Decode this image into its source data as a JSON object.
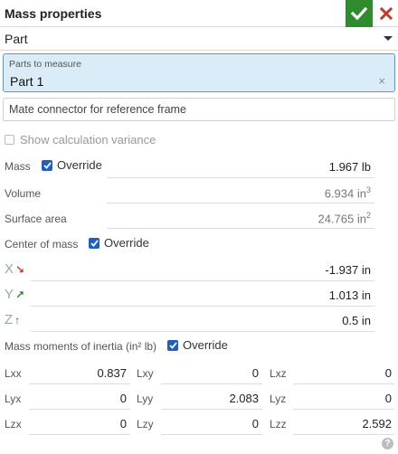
{
  "header": {
    "title": "Mass properties"
  },
  "mode": {
    "selected": "Part"
  },
  "parts": {
    "label": "Parts to measure",
    "value": "Part 1",
    "clear_glyph": "×"
  },
  "mate_connector": {
    "placeholder": "Mate connector for reference frame"
  },
  "variance": {
    "label": "Show calculation variance"
  },
  "override_label": "Override",
  "mass": {
    "label": "Mass",
    "value": "1.967 lb"
  },
  "volume": {
    "label": "Volume",
    "value": "6.934 in",
    "exp": "3"
  },
  "surface_area": {
    "label": "Surface area",
    "value": "24.765 in",
    "exp": "2"
  },
  "center_of_mass": {
    "label": "Center of mass",
    "x": {
      "axis": "X",
      "arrow": "↘",
      "value": "-1.937 in"
    },
    "y": {
      "axis": "Y",
      "arrow": "↗",
      "value": "1.013 in"
    },
    "z": {
      "axis": "Z",
      "arrow": "↑",
      "value": "0.5 in"
    }
  },
  "inertia": {
    "label": "Mass moments of inertia (in² lb)",
    "cells": [
      [
        {
          "label": "Lxx",
          "value": "0.837"
        },
        {
          "label": "Lxy",
          "value": "0"
        },
        {
          "label": "Lxz",
          "value": "0"
        }
      ],
      [
        {
          "label": "Lyx",
          "value": "0"
        },
        {
          "label": "Lyy",
          "value": "2.083"
        },
        {
          "label": "Lyz",
          "value": "0"
        }
      ],
      [
        {
          "label": "Lzx",
          "value": "0"
        },
        {
          "label": "Lzy",
          "value": "0"
        },
        {
          "label": "Lzz",
          "value": "2.592"
        }
      ]
    ]
  },
  "colors": {
    "accept": "#2e8b2e",
    "cancel": "#c0392b",
    "checkbox": "#1f5fbf",
    "selection_bg": "#d9ecf7",
    "x_axis": "#c0392b",
    "y_axis": "#2e8b2e",
    "z_axis": "#1f5fbf"
  },
  "icons": {
    "accept": "check-icon",
    "cancel": "close-icon",
    "help": "question-icon"
  }
}
